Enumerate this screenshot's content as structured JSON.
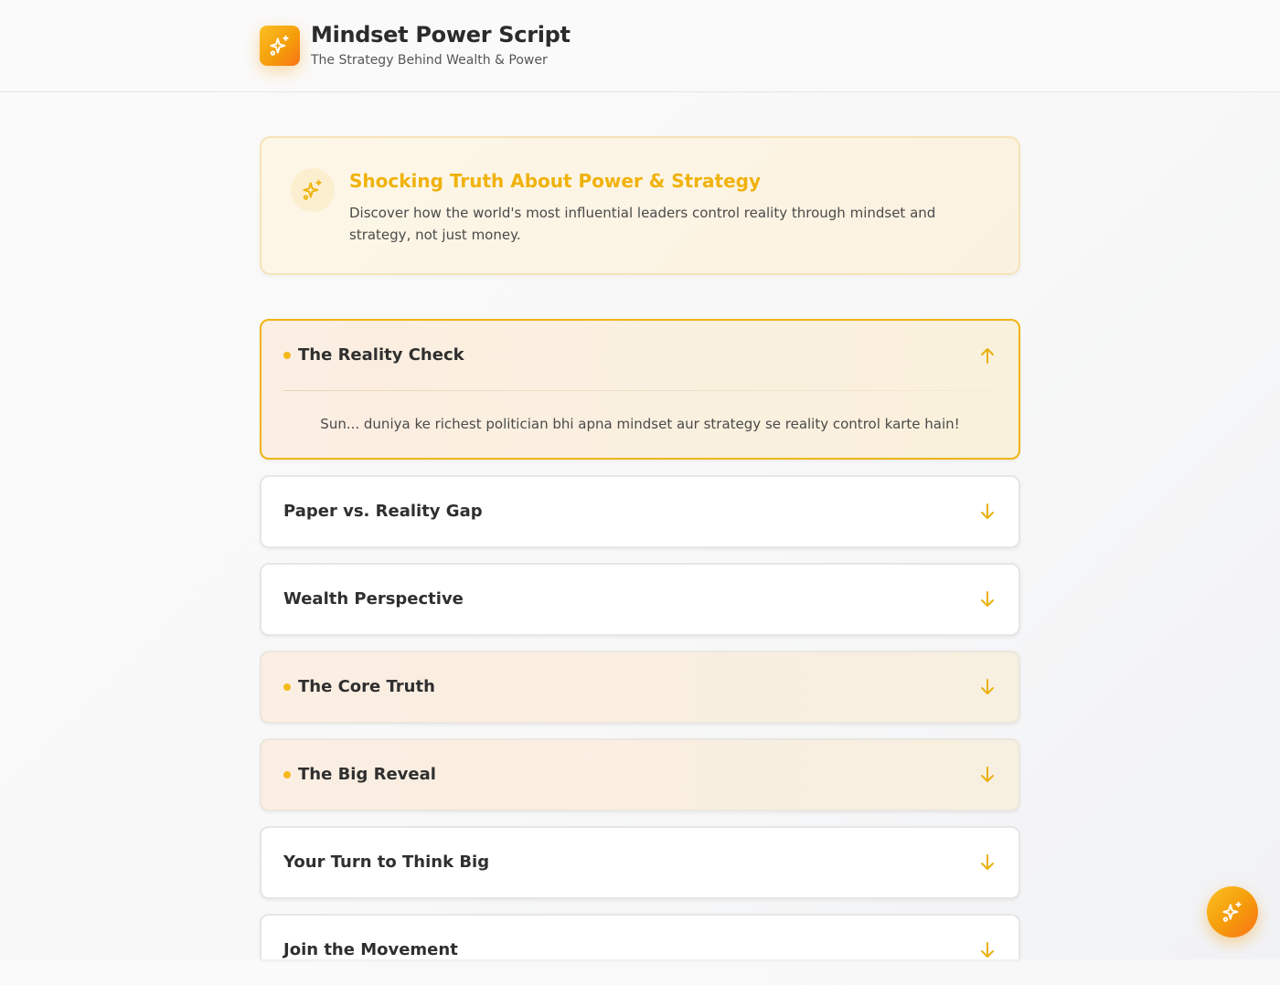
{
  "header": {
    "title": "Mindset Power Script",
    "subtitle": "The Strategy Behind Wealth & Power",
    "logo_icon": "sparkles-icon"
  },
  "intro": {
    "icon": "sparkles-icon",
    "title": "Shocking Truth About Power & Strategy",
    "text": "Discover how the world's most influential leaders control reality through mindset and strategy, not just money."
  },
  "sections": [
    {
      "title": "The Reality Check",
      "body": "Sun... duniya ke richest politician bhi apna mindset aur strategy se reality control karte hain!",
      "expanded": true,
      "highlighted": true
    },
    {
      "title": "Paper vs. Reality Gap",
      "expanded": false,
      "highlighted": false
    },
    {
      "title": "Wealth Perspective",
      "expanded": false,
      "highlighted": false
    },
    {
      "title": "The Core Truth",
      "expanded": false,
      "highlighted": true
    },
    {
      "title": "The Big Reveal",
      "expanded": false,
      "highlighted": true
    },
    {
      "title": "Your Turn to Think Big",
      "expanded": false,
      "highlighted": false
    },
    {
      "title": "Join the Movement",
      "expanded": false,
      "highlighted": false
    }
  ],
  "fab": {
    "icon": "sparkles-icon"
  },
  "colors": {
    "accent": "#f5b91c",
    "accent_orange": "#f97316",
    "intro_title": "#f0b20c",
    "open_border": "#f0b414"
  }
}
